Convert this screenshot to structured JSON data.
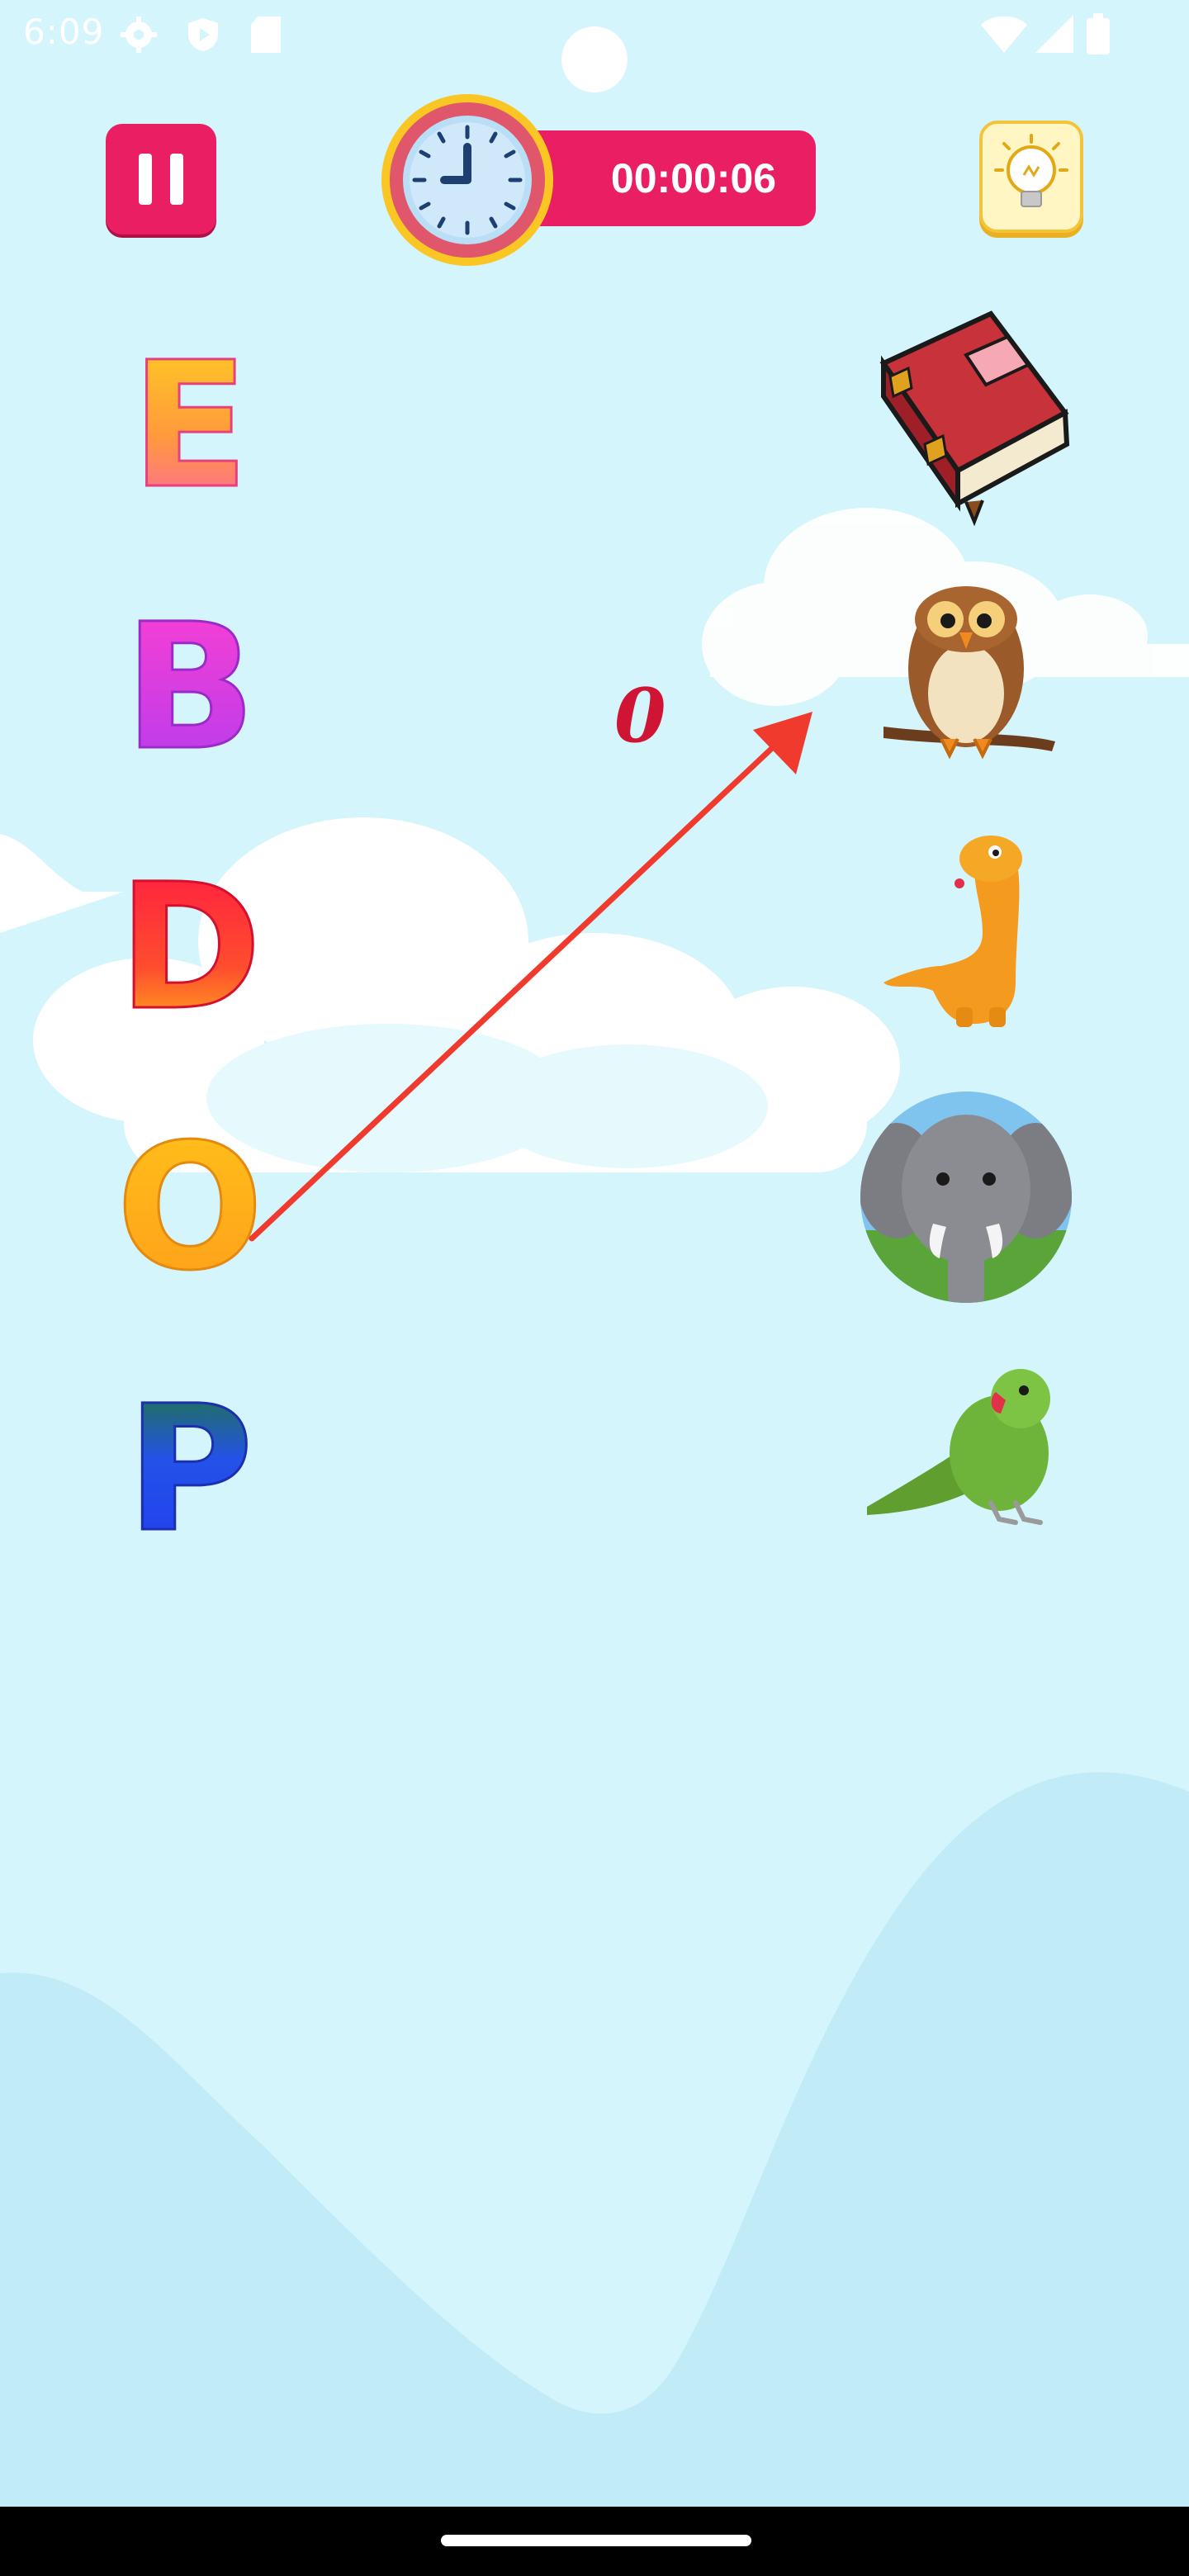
{
  "status_bar": {
    "time": "6:09",
    "icons": [
      "settings-gear-icon",
      "shield-play-icon",
      "sd-card-icon",
      "wifi-icon",
      "signal-icon",
      "battery-icon"
    ]
  },
  "top_bar": {
    "pause_icon": "pause-icon",
    "timer": "00:00:06",
    "timer_icon": "clock-icon",
    "hint_icon": "lightbulb-icon"
  },
  "letters": [
    "E",
    "B",
    "D",
    "O",
    "P"
  ],
  "pictures": [
    "book",
    "owl",
    "dinosaur",
    "elephant",
    "parrot"
  ],
  "stray_mark": "0",
  "colors": {
    "accent": "#e91e63",
    "background": "#d4f5fb",
    "arrow": "#f03a2e",
    "hint_yellow": "#f3c43a"
  }
}
